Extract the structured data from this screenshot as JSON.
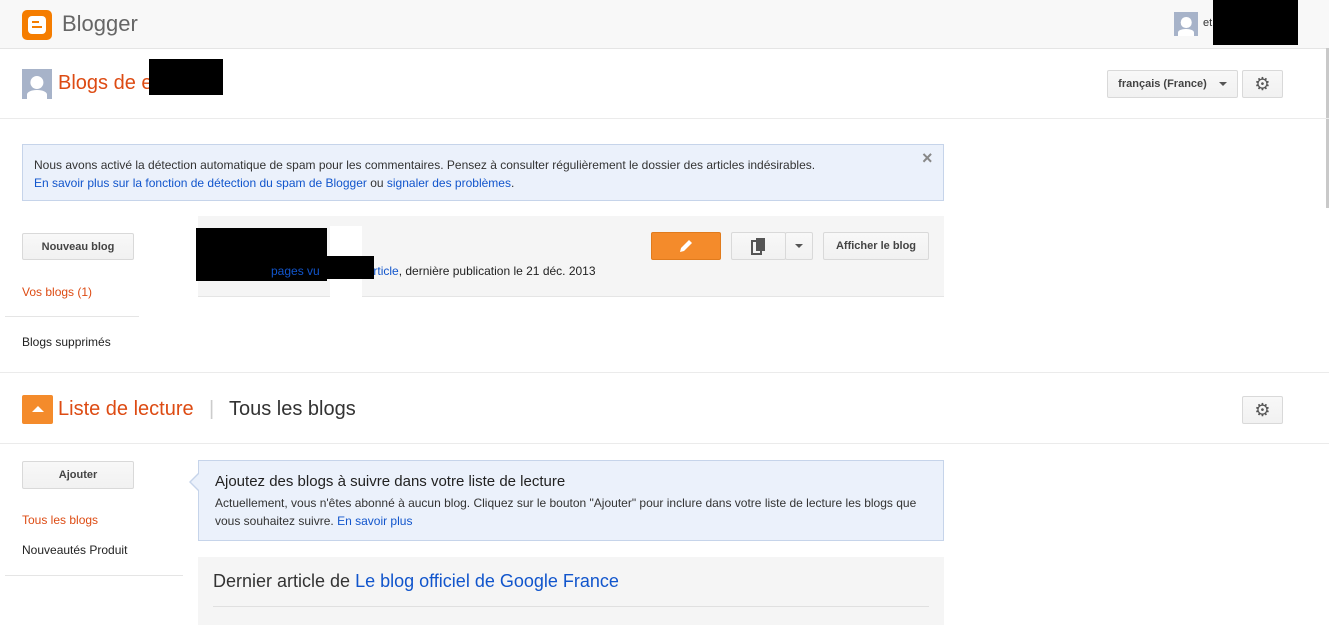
{
  "app": {
    "title": "Blogger",
    "user_short": "et"
  },
  "blogs_header": {
    "title": "Blogs de e",
    "language": "français (France)"
  },
  "spam_notice": {
    "line1": "Nous avons activé la détection automatique de spam pour les commentaires. Pensez à consulter régulièrement le dossier des articles indésirables.",
    "link1": "En savoir plus sur la fonction de détection du spam de Blogger",
    "middle": " ou ",
    "link2": "signaler des problèmes",
    "end": ".",
    "close": "×"
  },
  "sidebar": {
    "new_blog": "Nouveau blog",
    "your_blogs": "Vos blogs (1)",
    "deleted_blogs": "Blogs supprimés"
  },
  "blog_card": {
    "stats_link1": "pages vu",
    "stats_link2": "article",
    "stats_text": ", dernière publication le 21 déc. 2013",
    "view_blog": "Afficher le blog",
    "edit_icon": "pencil-icon",
    "posts_icon": "pages-icon"
  },
  "reading_list": {
    "title": "Liste de lecture",
    "separator": "|",
    "filter": "Tous les blogs",
    "add_button": "Ajouter",
    "nav_all": "Tous les blogs",
    "nav_news": "Nouveautés Produit",
    "notice_title": "Ajoutez des blogs à suivre dans votre liste de lecture",
    "notice_body": "Actuellement, vous n'êtes abonné à aucun blog. Cliquez sur le bouton \"Ajouter\" pour inclure dans votre liste de lecture les blogs que vous souhaitez suivre.",
    "notice_link": "En savoir plus",
    "latest_prefix": "Dernier article de ",
    "latest_blog": "Le blog officiel de Google France"
  },
  "colors": {
    "accent": "#dd4b13",
    "orange_button": "#f48b2b",
    "link": "#1155cc"
  }
}
